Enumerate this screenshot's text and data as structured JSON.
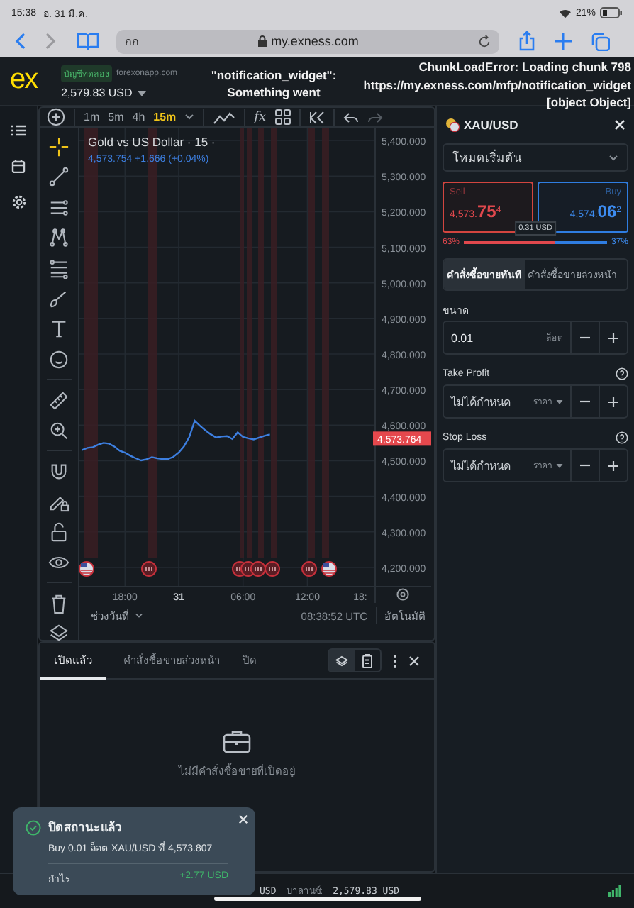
{
  "ios_status": {
    "time": "15:38",
    "date": "อ. 31 มี.ค.",
    "battery": "21%"
  },
  "browser": {
    "reader_button": "กก",
    "url": "my.exness.com"
  },
  "header": {
    "logo": "ex",
    "account_badge": "บัญชีทดลอง",
    "account_server": "forexonapp.com",
    "balance": "2,579.83 USD",
    "error_center": [
      "\"notification_widget\":",
      "Something went"
    ],
    "error_right": [
      "ChunkLoadError: Loading chunk 798",
      "https://my.exness.com/mfp/notification_widget",
      "[object Object]"
    ]
  },
  "toolbar": {
    "timeframes": [
      {
        "label": "1m",
        "selected": false
      },
      {
        "label": "5m",
        "selected": false
      },
      {
        "label": "4h",
        "selected": false
      },
      {
        "label": "15m",
        "selected": true
      }
    ],
    "indicators_button": "fx"
  },
  "drawing_tools": [
    {
      "kind": "crosshair",
      "selected": true
    },
    {
      "kind": "trend-line",
      "selected": false
    },
    {
      "kind": "parallel",
      "selected": false
    },
    {
      "kind": "pattern",
      "selected": false
    },
    {
      "kind": "fib",
      "selected": false
    },
    {
      "kind": "brush",
      "selected": false
    },
    {
      "kind": "text",
      "selected": false
    },
    {
      "kind": "emoji",
      "selected": false
    },
    {
      "kind": "ruler",
      "selected": false
    },
    {
      "kind": "zoom",
      "selected": false
    },
    {
      "kind": "magnet",
      "selected": false
    },
    {
      "kind": "pencil-lock",
      "selected": false
    },
    {
      "kind": "lock",
      "selected": false
    },
    {
      "kind": "eye",
      "selected": false
    },
    {
      "kind": "trash",
      "selected": false
    },
    {
      "kind": "layers",
      "selected": false
    }
  ],
  "chart": {
    "cut_time_label": "18:",
    "legend": "4,573.754  +1.666 (+0.04%)",
    "price_tag": "4,573.764",
    "chart_data": {
      "type": "line",
      "title": "Gold vs US Dollar · 15 ·",
      "categories": [
        null,
        null,
        null,
        null,
        null,
        null,
        null,
        null,
        "18:00",
        null,
        null,
        null,
        null,
        null,
        null,
        null,
        null,
        null,
        "31",
        null,
        null,
        null,
        null,
        null,
        null,
        null,
        null,
        null,
        null,
        null,
        "06:00",
        null,
        null,
        null,
        null,
        null,
        null,
        null,
        null,
        null,
        null,
        null,
        "12:00",
        null,
        null,
        null,
        null,
        null,
        null,
        null,
        null,
        null,
        null,
        null,
        null
      ],
      "series": [
        {
          "color": "#3d7fe0",
          "values": [
            4530,
            4536,
            4538,
            4545,
            4550,
            4548,
            4540,
            4528,
            4523,
            4514,
            4507,
            4501,
            4504,
            4510,
            4507,
            4505,
            4505,
            4511,
            4523,
            4540,
            4567,
            4612,
            4598,
            4585,
            4574,
            4565,
            4568,
            4569,
            4561,
            4580,
            4567,
            4563,
            4560,
            4565,
            4570,
            4574,
            null,
            null,
            null,
            null,
            null,
            null,
            null,
            null,
            null,
            null,
            null,
            null,
            null,
            null,
            null,
            null,
            null,
            null,
            null
          ]
        }
      ],
      "ylim": [
        4148,
        5436
      ],
      "grid": true,
      "yticks": [
        {
          "value": 5400,
          "label": "5,400.000"
        },
        {
          "value": 5300,
          "label": "5,300.000"
        },
        {
          "value": 5200,
          "label": "5,200.000"
        },
        {
          "value": 5100,
          "label": "5,100.000"
        },
        {
          "value": 5000,
          "label": "5,000.000"
        },
        {
          "value": 4900,
          "label": "4,900.000"
        },
        {
          "value": 4800,
          "label": "4,800.000"
        },
        {
          "value": 4700,
          "label": "4,700.000"
        },
        {
          "value": 4600,
          "label": "4,600.000"
        },
        {
          "value": 4500,
          "label": "4,500.000"
        },
        {
          "value": 4400,
          "label": "4,400.000"
        },
        {
          "value": 4300,
          "label": "4,300.000"
        },
        {
          "value": 4200,
          "label": "4,200.000"
        }
      ]
    }
  },
  "chart_footer": {
    "range": "ช่วงวันที่",
    "time": "08:38:52 UTC",
    "scale": "อัตโนมัติ"
  },
  "positions_panel": {
    "tabs": [
      {
        "label": "เปิดแล้ว",
        "selected": true
      },
      {
        "label": "คำสั่งซื้อขายล่วงหน้า",
        "selected": false
      },
      {
        "label": "ปิด",
        "selected": false
      }
    ],
    "view_toggle": [
      {
        "kind": "stack",
        "selected": true
      },
      {
        "kind": "clipboard",
        "selected": false
      }
    ],
    "empty_text": "ไม่มีคำสั่งซื้อขายที่เปิดอยู่"
  },
  "account_bar": {
    "equity_tail": "USD",
    "balance_label": "บาลานซ์:",
    "balance": "2,579.83 USD"
  },
  "toast": {
    "title": "ปิดสถานะแล้ว",
    "message": "Buy 0.01 ล็อต XAU/USD ที่ 4,573.807",
    "profit_label": "กำไร",
    "profit": "+2.77 USD"
  },
  "order_panel": {
    "symbol": "XAU/USD",
    "mode": "โหมดเริ่มต้น",
    "sell": {
      "label": "Sell",
      "price": "4,573.**75**$^{4}$"
    },
    "buy": {
      "label": "Buy",
      "price": "4,574.**06**$^{2}$"
    },
    "spread": "0.31 USD",
    "sentiment": {
      "sell_label": "63%",
      "buy_label": "37%",
      "level": 0.63
    },
    "order_types": [
      {
        "label": "คำสั่งซื้อขายทันที",
        "selected": true
      },
      {
        "label": "คำสั่งซื้อขายล่วงหน้า",
        "selected": false
      }
    ],
    "fields": [
      {
        "kind": "volume",
        "label": "ขนาด",
        "value": "0.01",
        "unit": "ล็อต"
      },
      {
        "kind": "price",
        "label": "Take Profit",
        "placeholder": "ไม่ได้กำหนด",
        "unit": "ราคา"
      },
      {
        "kind": "price",
        "label": "Stop Loss",
        "placeholder": "ไม่ได้กำหนด",
        "unit": "ราคา"
      }
    ]
  }
}
